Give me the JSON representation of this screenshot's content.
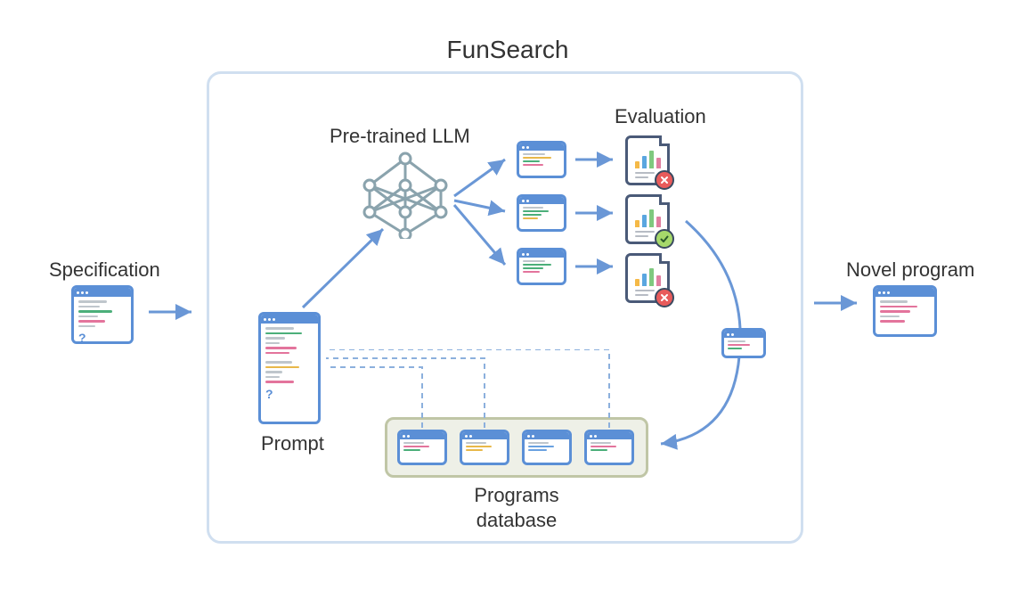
{
  "diagram": {
    "title": "FunSearch",
    "nodes": {
      "specification": "Specification",
      "prompt": "Prompt",
      "llm": "Pre-trained LLM",
      "evaluation": "Evaluation",
      "db": "Programs\ndatabase",
      "output": "Novel program"
    },
    "evaluation_results": [
      "fail",
      "pass",
      "fail"
    ],
    "database_item_count": 4,
    "llm_output_count": 3,
    "colors": {
      "border_light": "#d0dff0",
      "card_border": "#5b8fd6",
      "arrow": "#6a97d6",
      "db_border": "#c0c6a6",
      "db_fill": "#eef0e7",
      "nn": "#8aa3ad",
      "badge_fail": "#e85b5b",
      "badge_pass": "#a6d96a"
    }
  }
}
